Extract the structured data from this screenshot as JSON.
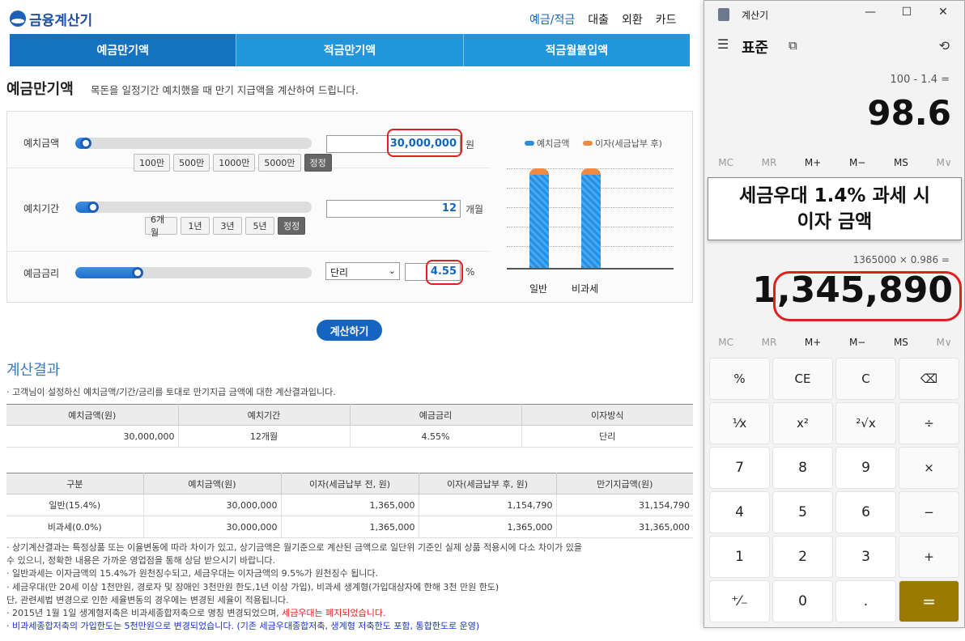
{
  "header": {
    "logo": "금융계산기",
    "nav": [
      "예금/적금",
      "대출",
      "외환",
      "카드"
    ]
  },
  "tabs": [
    "예금만기액",
    "적금만기액",
    "적금월불입액"
  ],
  "page": {
    "title": "예금만기액",
    "desc": "목돈을 일정기간 예치했을 때 만기 지급액을 계산하여 드립니다."
  },
  "form": {
    "deposit": {
      "label": "예치금액",
      "value": "30,000,000",
      "unit": "원",
      "quick": [
        "100만",
        "500만",
        "1000만",
        "5000만"
      ],
      "reset": "정정",
      "level": 0.02
    },
    "period": {
      "label": "예치기간",
      "value": "12",
      "unit": "개월",
      "quick": [
        "6개월",
        "1년",
        "3년",
        "5년"
      ],
      "reset": "정정",
      "level": 0.05
    },
    "rate": {
      "label": "예금금리",
      "type": "단리",
      "value": "4.55",
      "unit": "%",
      "level": 0.24
    }
  },
  "chart_data": {
    "type": "bar",
    "categories": [
      "일반",
      "비과세"
    ],
    "series": [
      {
        "name": "예치금액",
        "values": [
          30000000,
          30000000
        ]
      },
      {
        "name": "이자(세금납부 후)",
        "values": [
          1154790,
          1365000
        ]
      }
    ],
    "colors": {
      "deposit": "#2a8ee0",
      "interest": "#f08a40"
    }
  },
  "calc_button": "계산하기",
  "result": {
    "title": "계산결과",
    "desc": "· 고객님이 설정하신 예치금액/기간/금리를 토대로 만기지급 금액에 대한 계산결과입니다.",
    "table1": {
      "headers": [
        "예치금액(원)",
        "예치기간",
        "예금금리",
        "이자방식"
      ],
      "row": [
        "30,000,000",
        "12개월",
        "4.55%",
        "단리"
      ]
    },
    "table2": {
      "headers": [
        "구분",
        "예치금액(원)",
        "이자(세금납부 전, 원)",
        "이자(세금납부 후, 원)",
        "만기지급액(원)"
      ],
      "rows": [
        [
          "일반(15.4%)",
          "30,000,000",
          "1,365,000",
          "1,154,790",
          "31,154,790"
        ],
        [
          "비과세(0.0%)",
          "30,000,000",
          "1,365,000",
          "1,365,000",
          "31,365,000"
        ]
      ]
    },
    "notes": [
      "· 상기계산결과는 특정상품 또는 이율변동에 따라 차이가 있고, 상기금액은 월기준으로 계산된 금액으로 일단위 기준인 실제 상품 적용시에 다소 차이가 있을",
      "  수 있으니, 정확한 내용은 가까운 영업점을 통해 상담 받으시기 바랍니다.",
      "· 일반과세는 이자금액의 15.4%가 원천징수되고, 세금우대는 이자금액의 9.5%가 원천징수 됩니다.",
      "· 세금우대(만 20세 이상 1천만원, 경로자 및 장애인 3천만원 한도,1년 이상 가입), 비과세 생계형(가입대상자에 한해 3천 만원 한도)",
      "  단, 관련세법 변경으로 인한 세율변동의 경우에는 변경된 세율이 적용됩니다."
    ],
    "note6a": "· 2015년 1월 1일 생계형저축은 비과세종합저축으로 명칭 변경되었으며, ",
    "note6b": "세금우대는 폐지되었습니다.",
    "note7": "· 비과세종합저축의 가입한도는 5천만원으로 변경되었습니다. (기존 세금우대종합저축, 생계형 저축한도 포함, 통합한도로 운영)"
  },
  "calculator": {
    "title": "계산기",
    "mode": "표준",
    "expr1": "100 - 1.4 =",
    "display1": "98.6",
    "mem": [
      "MC",
      "MR",
      "M+",
      "M−",
      "MS",
      "M∨"
    ],
    "overlay": "세금우대 1.4% 과세 시\n이자 금액",
    "expr2": "1365000 × 0.986 =",
    "display2": "1,345,890",
    "keys": [
      [
        "%",
        "pct"
      ],
      [
        "CE",
        "ce"
      ],
      [
        "C",
        "c"
      ],
      [
        "⌫",
        "backspace"
      ],
      [
        "¹⁄x",
        "recip"
      ],
      [
        "x²",
        "sq"
      ],
      [
        "²√x",
        "sqrt"
      ],
      [
        "÷",
        "div"
      ],
      [
        "7",
        "n7"
      ],
      [
        "8",
        "n8"
      ],
      [
        "9",
        "n9"
      ],
      [
        "×",
        "mul"
      ],
      [
        "4",
        "n4"
      ],
      [
        "5",
        "n5"
      ],
      [
        "6",
        "n6"
      ],
      [
        "−",
        "minus"
      ],
      [
        "1",
        "n1"
      ],
      [
        "2",
        "n2"
      ],
      [
        "3",
        "n3"
      ],
      [
        "+",
        "plus"
      ],
      [
        "⁺⁄₋",
        "negate"
      ],
      [
        "0",
        "n0"
      ],
      [
        ".",
        "dot"
      ],
      [
        "=",
        "equals"
      ]
    ]
  }
}
